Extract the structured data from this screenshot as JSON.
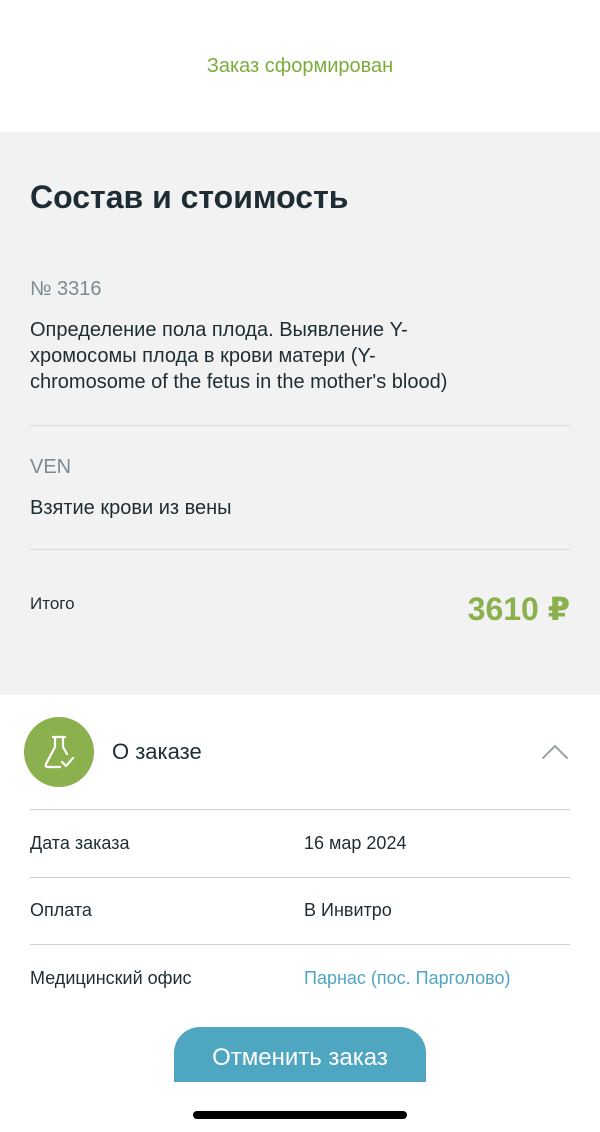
{
  "status": {
    "text": "Заказ сформирован"
  },
  "composition": {
    "title": "Состав и стоимость",
    "items": [
      {
        "code": "№ 3316",
        "name": "Определение пола плода. Выявление Y-хромосомы плода в крови матери (Y-chromosome of the fetus in the mother's blood)"
      },
      {
        "code": "VEN",
        "name": "Взятие крови из вены"
      }
    ],
    "total_label": "Итого",
    "total_value": "3610 ₽"
  },
  "order": {
    "title": "О заказе",
    "icon": "flask-check-icon",
    "rows": [
      {
        "label": "Дата заказа",
        "value": "16 мар 2024"
      },
      {
        "label": "Оплата",
        "value": "В Инвитро"
      },
      {
        "label": "Медицинский офис",
        "value": "Парнас (пос. Парголово)"
      }
    ]
  },
  "actions": {
    "cancel_label": "Отменить заказ"
  },
  "colors": {
    "accent_green": "#8bb14f",
    "status_green": "#7cac3c",
    "link_blue": "#4ea6c0",
    "panel_gray": "#f2f2f2"
  }
}
